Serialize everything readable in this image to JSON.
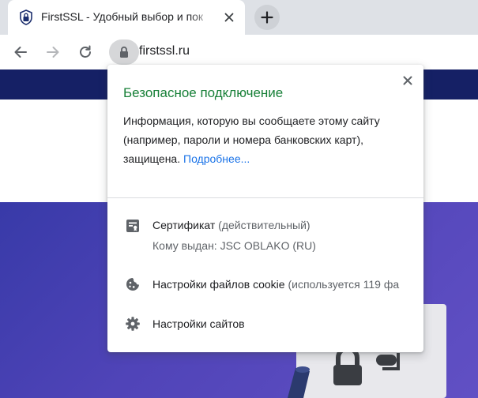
{
  "tab": {
    "title": "FirstSSL - Удобный выбор и пок",
    "favicon": "shield-lock-icon"
  },
  "toolbar": {
    "back_icon": "back-arrow-icon",
    "forward_icon": "forward-arrow-icon",
    "reload_icon": "reload-icon",
    "lock_icon": "lock-icon",
    "url": "firstssl.ru"
  },
  "popup": {
    "title": "Безопасное подключение",
    "description": "Информация, которую вы сообщаете этому сайту (например, пароли и номера банковских карт), защищена.",
    "link": "Подробнее...",
    "certificate": {
      "icon": "certificate-icon",
      "label": "Сертификат",
      "status": "(действительный)",
      "issued_to": "Кому выдан: JSC OBLAKO (RU)"
    },
    "cookies": {
      "icon": "cookie-icon",
      "label": "Настройки файлов cookie",
      "usage": "(используется 119 фа"
    },
    "site_settings": {
      "icon": "gear-icon",
      "label": "Настройки сайтов"
    }
  },
  "colors": {
    "title_green": "#188038",
    "link_blue": "#1a73e8",
    "navbar": "#152065",
    "hero": "#4f44b6"
  }
}
